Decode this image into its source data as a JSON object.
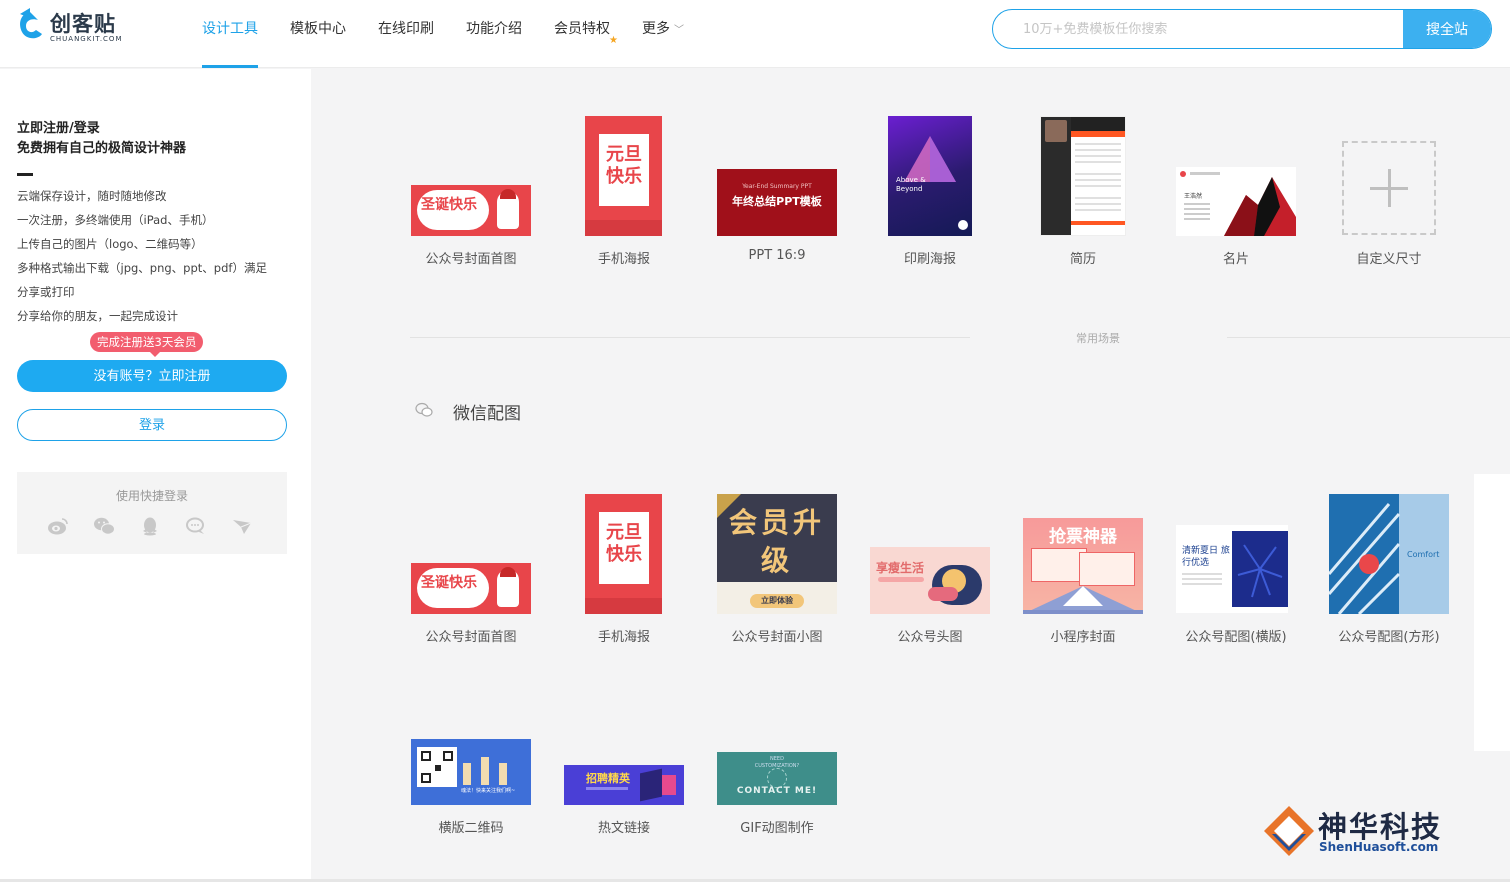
{
  "header": {
    "logo_text": "创客贴",
    "logo_sub": "CHUANGKIT.COM",
    "nav": [
      {
        "label": "设计工具",
        "active": true
      },
      {
        "label": "模板中心"
      },
      {
        "label": "在线印刷"
      },
      {
        "label": "功能介绍"
      },
      {
        "label": "会员特权"
      },
      {
        "label": "更多"
      }
    ],
    "search_placeholder": "10万+免费模板任你搜索",
    "search_button": "搜全站"
  },
  "sidebar": {
    "title_line1": "立即注册/登录",
    "title_line2": "免费拥有自己的极简设计神器",
    "benefits": [
      "云端保存设计，随时随地修改",
      "一次注册，多终端使用（iPad、手机）",
      "上传自己的图片（logo、二维码等）",
      "多种格式输出下载（jpg、png、ppt、pdf）满足",
      "分享或打印",
      "分享给你的朋友，一起完成设计"
    ],
    "badge": "完成注册送3天会员",
    "register_button": "没有账号？立即注册",
    "login_button": "登录",
    "quick_login_label": "使用快捷登录",
    "quick_login_icons": [
      "weibo-icon",
      "wechat-icon",
      "qq-icon",
      "chat-icon",
      "plane-icon"
    ]
  },
  "main": {
    "top_templates": [
      {
        "label": "公众号封面首图",
        "thumb_text": "圣诞快乐"
      },
      {
        "label": "手机海报",
        "thumb_text": "元旦快乐"
      },
      {
        "label": "PPT 16:9",
        "thumb_text": "年终总结PPT模板"
      },
      {
        "label": "印刷海报",
        "thumb_text": "Above & Beyond"
      },
      {
        "label": "简历",
        "thumb_text": ""
      },
      {
        "label": "名片",
        "thumb_text": "王浩然"
      },
      {
        "label": "自定义尺寸",
        "thumb_text": "+"
      }
    ],
    "divider_text": "常用场景",
    "section_title": "微信配图",
    "wechat_templates": [
      {
        "label": "公众号封面首图",
        "thumb_text": "圣诞快乐"
      },
      {
        "label": "手机海报",
        "thumb_text": "元旦快乐"
      },
      {
        "label": "公众号封面小图",
        "thumb_text": "会员升级",
        "sub": "立即体验"
      },
      {
        "label": "公众号头图",
        "thumb_text": "享瘦生活"
      },
      {
        "label": "小程序封面",
        "thumb_text": "抢票神器"
      },
      {
        "label": "公众号配图(横版)",
        "thumb_text": "清新夏日 旅行优选"
      },
      {
        "label": "公众号配图(方形)",
        "thumb_text": "Comfort"
      }
    ],
    "more_templates": [
      {
        "label": "横版二维码",
        "thumb_text": "魂法！快来关注我们啊~"
      },
      {
        "label": "热文链接",
        "thumb_text": "招聘精英"
      },
      {
        "label": "GIF动图制作",
        "thumb_text": "CONTACT ME!"
      }
    ]
  },
  "watermark": {
    "text": "神华科技",
    "sub": "ShenHuasoft.com"
  },
  "colors": {
    "accent": "#1ea2e8",
    "badge": "#f25d6e"
  }
}
